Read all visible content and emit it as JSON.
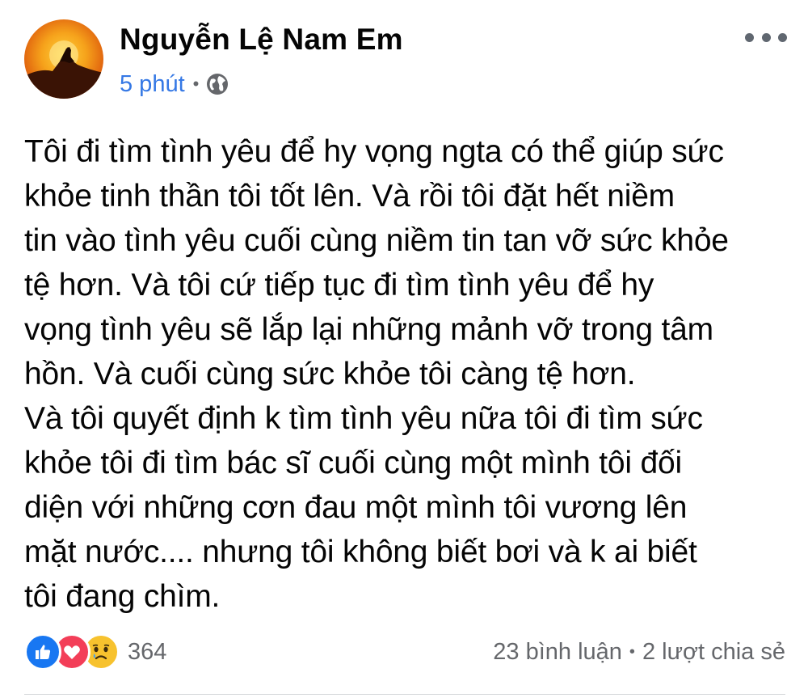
{
  "post": {
    "author": "Nguyễn Lệ Nam Em",
    "time": "5 phút",
    "privacy_icon": "globe-icon",
    "more_icon": "more-options-icon",
    "text": "Tôi đi tìm tình yêu để hy vọng ngta có thể giúp sức\nkhỏe tinh thần tôi tốt lên. Và rồi tôi đặt hết niềm\ntin vào tình yêu cuối cùng niềm tin tan vỡ sức khỏe\ntệ hơn. Và tôi cứ tiếp tục đi tìm tình yêu để hy\nvọng tình yêu sẽ lắp lại những mảnh vỡ trong tâm\nhồn. Và cuối cùng sức khỏe tôi càng tệ hơn.\nVà tôi quyết định k tìm tình yêu nữa tôi đi tìm sức\nkhỏe tôi đi tìm bác sĩ cuối cùng một mình tôi đối\ndiện với những cơn đau một mình tôi vương lên\nmặt nước.... nhưng tôi không biết bơi và k ai biết\ntôi đang chìm.",
    "reactions": {
      "icons": [
        "like-icon",
        "love-icon",
        "sad-icon"
      ],
      "count": "364"
    },
    "comments": "23 bình luận",
    "shares": "2 lượt chia sẻ"
  },
  "colors": {
    "link_blue": "#3578e5",
    "secondary_text": "#65676b",
    "like_blue": "#1877f2",
    "love_red": "#f33e58",
    "sad_yellow": "#f7c22e"
  }
}
